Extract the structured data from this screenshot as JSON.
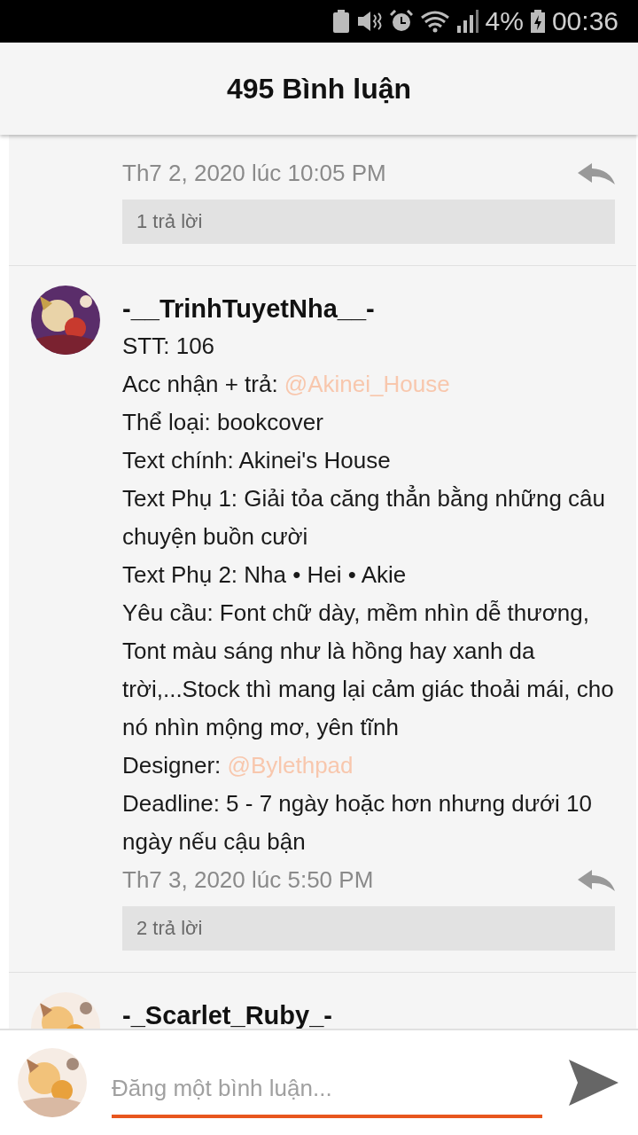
{
  "status_bar": {
    "battery": "4%",
    "time": "00:36"
  },
  "header": {
    "title": "495 Bình luận"
  },
  "comments": [
    {
      "time": "Th7 2, 2020 lúc 10:05 PM",
      "replies": "1 trả lời"
    },
    {
      "author": "-__TrinhTuyetNha__-",
      "lines": [
        {
          "text": "STT: 106"
        },
        {
          "text": "Acc nhận + trả: ",
          "mention": "@Akinei_House"
        },
        {
          "text": "Thể loại: bookcover"
        },
        {
          "text": "Text chính: Akinei's House"
        },
        {
          "text": "Text Phụ 1: Giải tỏa căng thẳn bằng những câu chuyện buồn cười"
        },
        {
          "text": "Text Phụ 2: Nha • Hei • Akie"
        },
        {
          "text": "Yêu cầu: Font chữ dày, mềm nhìn dễ thương, Tont màu sáng như là hồng hay xanh da trời,...Stock thì mang lại cảm giác thoải mái, cho nó nhìn mộng mơ, yên tĩnh"
        },
        {
          "text": "Designer: ",
          "mention": "@Bylethpad"
        },
        {
          "text": "Deadline: 5 - 7 ngày hoặc hơn nhưng dưới 10 ngày nếu cậu bận"
        }
      ],
      "time": "Th7 3, 2020 lúc 5:50 PM",
      "replies": "2 trả lời"
    },
    {
      "author": "-_Scarlet_Ruby_-"
    }
  ],
  "composer": {
    "placeholder": "Đăng một bình luận..."
  }
}
